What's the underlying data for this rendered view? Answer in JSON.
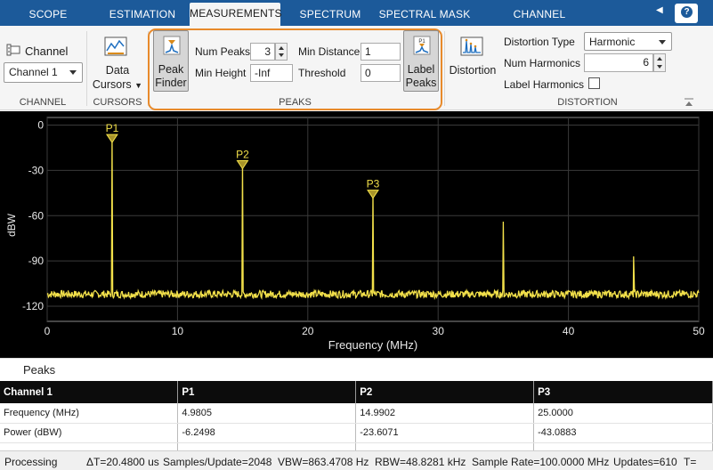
{
  "tabs": [
    {
      "label": "SCOPE",
      "active": false
    },
    {
      "label": "ESTIMATION",
      "active": false
    },
    {
      "label": "MEASUREMENTS",
      "active": true
    },
    {
      "label": "SPECTRUM",
      "active": false
    },
    {
      "label": "SPECTRAL MASK",
      "active": false
    },
    {
      "label": "CHANNEL MEASUREMENTS",
      "active": false
    }
  ],
  "help_label": "?",
  "ribbon": {
    "channel": {
      "label": "Channel",
      "value": "Channel 1",
      "group": "CHANNEL"
    },
    "cursors": {
      "button_line1": "Data",
      "button_line2": "Cursors",
      "group": "CURSORS"
    },
    "peaks": {
      "peak_finder_line1": "Peak",
      "peak_finder_line2": "Finder",
      "num_peaks_label": "Num Peaks",
      "num_peaks_value": "3",
      "min_height_label": "Min Height",
      "min_height_value": "-Inf",
      "min_distance_label": "Min Distance",
      "min_distance_value": "1",
      "threshold_label": "Threshold",
      "threshold_value": "0",
      "label_peaks_line1": "Label",
      "label_peaks_line2": "Peaks",
      "group": "PEAKS"
    },
    "distortion": {
      "button_label": "Distortion",
      "type_label": "Distortion Type",
      "type_value": "Harmonic",
      "num_harmonics_label": "Num Harmonics",
      "num_harmonics_value": "6",
      "label_harmonics_label": "Label Harmonics",
      "group": "DISTORTION"
    }
  },
  "colors": {
    "tab_bar": "#1c5a9a",
    "trace": "#f2e04a",
    "highlight": "#e88a2b",
    "plot_bg": "#000000"
  },
  "chart_data": {
    "type": "line",
    "xlabel": "Frequency (MHz)",
    "ylabel": "dBW",
    "xlim": [
      0,
      50
    ],
    "ylim": [
      -130,
      5
    ],
    "xticks": [
      0,
      10,
      20,
      30,
      40,
      50
    ],
    "yticks": [
      0,
      -30,
      -60,
      -90,
      -120
    ],
    "grid": true,
    "noise_floor": -112,
    "spikes": [
      {
        "x": 4.9805,
        "y": -6.2498
      },
      {
        "x": 14.9902,
        "y": -23.6071
      },
      {
        "x": 25.0,
        "y": -43.0883
      },
      {
        "x": 35.0,
        "y": -64
      },
      {
        "x": 45.0,
        "y": -87
      }
    ],
    "markers": [
      {
        "label": "P1",
        "x": 4.9805,
        "y": -6.2498
      },
      {
        "label": "P2",
        "x": 14.9902,
        "y": -23.6071
      },
      {
        "label": "P3",
        "x": 25.0,
        "y": -43.0883
      }
    ]
  },
  "peaks_panel": {
    "title": "Peaks",
    "header": [
      "Channel 1",
      "P1",
      "P2",
      "P3"
    ],
    "rows": [
      [
        "Frequency (MHz)",
        "4.9805",
        "14.9902",
        "25.0000"
      ],
      [
        "Power (dBW)",
        "-6.2498",
        "-23.6071",
        "-43.0883"
      ],
      [
        "",
        "",
        "",
        ""
      ]
    ]
  },
  "status": {
    "state": "Processing",
    "delta_t": "ΔT=20.4800 us",
    "samples": "Samples/Update=2048",
    "vbw": "VBW=863.4708 Hz",
    "rbw": "RBW=48.8281 kHz",
    "sample_rate": "Sample Rate=100.0000 MHz",
    "updates": "Updates=610",
    "tail": "T="
  }
}
